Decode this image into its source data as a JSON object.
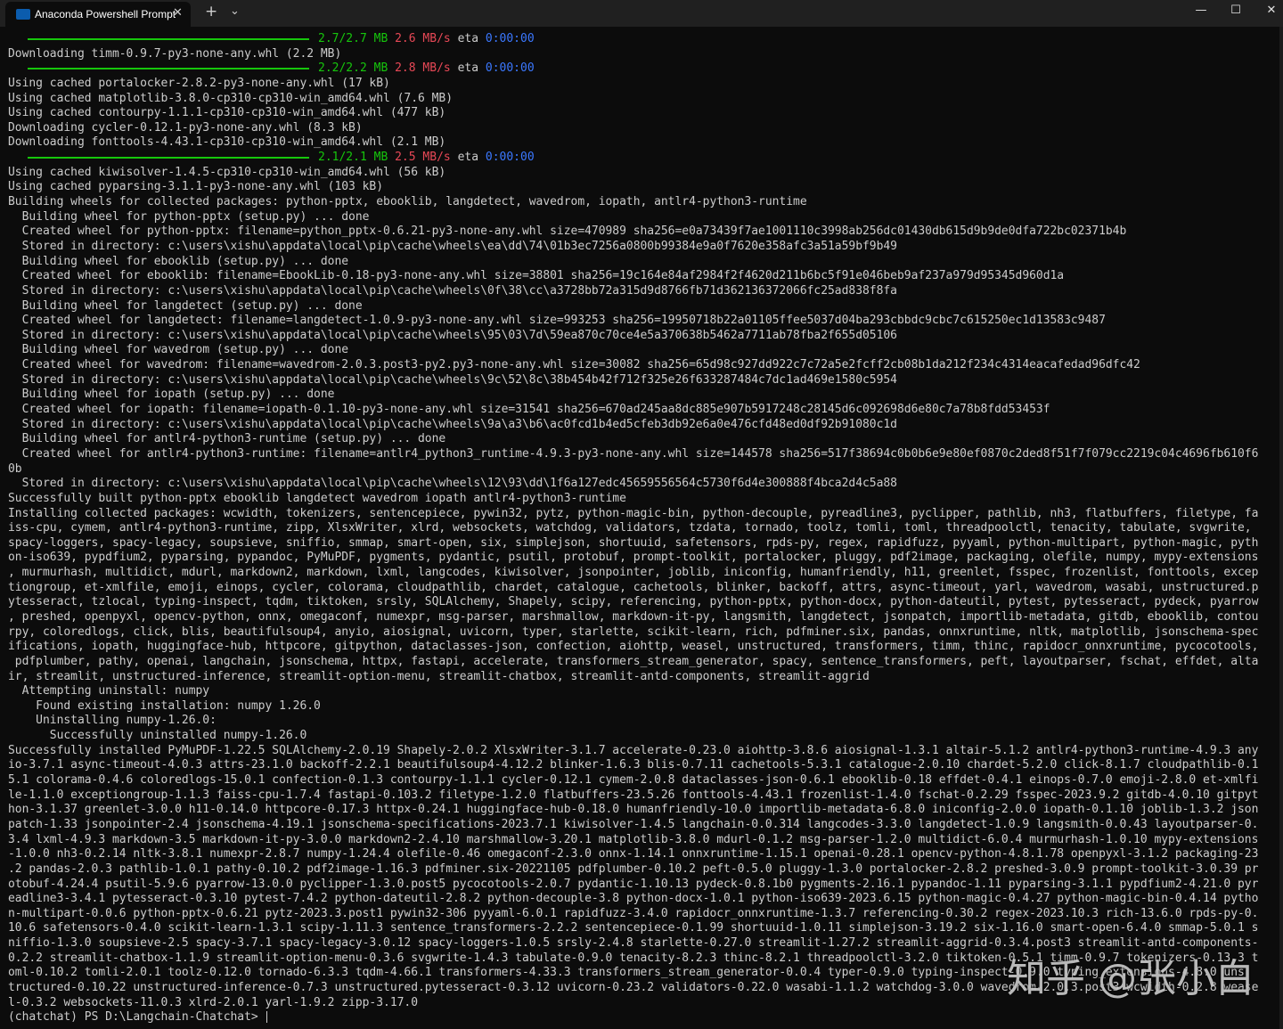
{
  "window": {
    "tab_title": "Anaconda Powershell Prompt",
    "tab_close": "✕",
    "new_tab": "+",
    "dropdown": "⌄",
    "minimize": "—",
    "maximize": "☐",
    "close": "✕"
  },
  "colors": {
    "background": "#0c0c0c",
    "titlebar": "#202020",
    "progress_green": "#16c60c",
    "speed_red": "#e74856",
    "eta_blue": "#3b78ff",
    "text": "#cccccc"
  },
  "progress": [
    {
      "size": "2.7/2.7 MB",
      "speed": "2.6 MB/s",
      "eta_label": "eta",
      "eta": "0:00:00"
    },
    {
      "size": "2.2/2.2 MB",
      "speed": "2.8 MB/s",
      "eta_label": "eta",
      "eta": "0:00:00"
    },
    {
      "size": "2.1/2.1 MB",
      "speed": "2.5 MB/s",
      "eta_label": "eta",
      "eta": "0:00:00"
    }
  ],
  "lines": {
    "l01": "Downloading timm-0.9.7-py3-none-any.whl (2.2 MB)",
    "l02": "Using cached portalocker-2.8.2-py3-none-any.whl (17 kB)",
    "l03": "Using cached matplotlib-3.8.0-cp310-cp310-win_amd64.whl (7.6 MB)",
    "l04": "Using cached contourpy-1.1.1-cp310-cp310-win_amd64.whl (477 kB)",
    "l05": "Downloading cycler-0.12.1-py3-none-any.whl (8.3 kB)",
    "l06": "Downloading fonttools-4.43.1-cp310-cp310-win_amd64.whl (2.1 MB)",
    "l07": "Using cached kiwisolver-1.4.5-cp310-cp310-win_amd64.whl (56 kB)",
    "l08": "Using cached pyparsing-3.1.1-py3-none-any.whl (103 kB)",
    "l09": "Building wheels for collected packages: python-pptx, ebooklib, langdetect, wavedrom, iopath, antlr4-python3-runtime",
    "l10": "  Building wheel for python-pptx (setup.py) ... done",
    "l11": "  Created wheel for python-pptx: filename=python_pptx-0.6.21-py3-none-any.whl size=470989 sha256=e0a73439f7ae1001110c3998ab256dc01430db615d9b9de0dfa722bc02371b4b",
    "l12": "  Stored in directory: c:\\users\\xishu\\appdata\\local\\pip\\cache\\wheels\\ea\\dd\\74\\01b3ec7256a0800b99384e9a0f7620e358afc3a51a59bf9b49",
    "l13": "  Building wheel for ebooklib (setup.py) ... done",
    "l14": "  Created wheel for ebooklib: filename=EbookLib-0.18-py3-none-any.whl size=38801 sha256=19c164e84af2984f2f4620d211b6bc5f91e046beb9af237a979d95345d960d1a",
    "l15": "  Stored in directory: c:\\users\\xishu\\appdata\\local\\pip\\cache\\wheels\\0f\\38\\cc\\a3728bb72a315d9d8766fb71d362136372066fc25ad838f8fa",
    "l16": "  Building wheel for langdetect (setup.py) ... done",
    "l17": "  Created wheel for langdetect: filename=langdetect-1.0.9-py3-none-any.whl size=993253 sha256=19950718b22a01105ffee5037d04ba293cbbdc9cbc7c615250ec1d13583c9487",
    "l18": "  Stored in directory: c:\\users\\xishu\\appdata\\local\\pip\\cache\\wheels\\95\\03\\7d\\59ea870c70ce4e5a370638b5462a7711ab78fba2f655d05106",
    "l19": "  Building wheel for wavedrom (setup.py) ... done",
    "l20": "  Created wheel for wavedrom: filename=wavedrom-2.0.3.post3-py2.py3-none-any.whl size=30082 sha256=65d98c927dd922c7c72a5e2fcff2cb08b1da212f234c4314eacafedad96dfc42",
    "l21": "  Stored in directory: c:\\users\\xishu\\appdata\\local\\pip\\cache\\wheels\\9c\\52\\8c\\38b454b42f712f325e26f633287484c7dc1ad469e1580c5954",
    "l22": "  Building wheel for iopath (setup.py) ... done",
    "l23": "  Created wheel for iopath: filename=iopath-0.1.10-py3-none-any.whl size=31541 sha256=670ad245aa8dc885e907b5917248c28145d6c092698d6e80c7a78b8fdd53453f",
    "l24": "  Stored in directory: c:\\users\\xishu\\appdata\\local\\pip\\cache\\wheels\\9a\\a3\\b6\\ac0fcd1b4ed5cfeb3db92e6a0e476cfd48ed0df92b91080c1d",
    "l25": "  Building wheel for antlr4-python3-runtime (setup.py) ... done",
    "l26": "  Created wheel for antlr4-python3-runtime: filename=antlr4_python3_runtime-4.9.3-py3-none-any.whl size=144578 sha256=517f38694c0b0b6e9e80ef0870c2ded8f51f7f079cc2219c04c4696fb610f6",
    "l27": "0b",
    "l28": "  Stored in directory: c:\\users\\xishu\\appdata\\local\\pip\\cache\\wheels\\12\\93\\dd\\1f6a127edc45659556564c5730f6d4e300888f4bca2d4c5a88",
    "l29": "Successfully built python-pptx ebooklib langdetect wavedrom iopath antlr4-python3-runtime",
    "l30": "Installing collected packages: wcwidth, tokenizers, sentencepiece, pywin32, pytz, python-magic-bin, python-decouple, pyreadline3, pyclipper, pathlib, nh3, flatbuffers, filetype, fa",
    "l31": "iss-cpu, cymem, antlr4-python3-runtime, zipp, XlsxWriter, xlrd, websockets, watchdog, validators, tzdata, tornado, toolz, tomli, toml, threadpoolctl, tenacity, tabulate, svgwrite,",
    "l32": "spacy-loggers, spacy-legacy, soupsieve, sniffio, smmap, smart-open, six, simplejson, shortuuid, safetensors, rpds-py, regex, rapidfuzz, pyyaml, python-multipart, python-magic, pyth",
    "l33": "on-iso639, pypdfium2, pyparsing, pypandoc, PyMuPDF, pygments, pydantic, psutil, protobuf, prompt-toolkit, portalocker, pluggy, pdf2image, packaging, olefile, numpy, mypy-extensions",
    "l34": ", murmurhash, multidict, mdurl, markdown2, markdown, lxml, langcodes, kiwisolver, jsonpointer, joblib, iniconfig, humanfriendly, h11, greenlet, fsspec, frozenlist, fonttools, excep",
    "l35": "tiongroup, et-xmlfile, emoji, einops, cycler, colorama, cloudpathlib, chardet, catalogue, cachetools, blinker, backoff, attrs, async-timeout, yarl, wavedrom, wasabi, unstructured.p",
    "l36": "ytesseract, tzlocal, typing-inspect, tqdm, tiktoken, srsly, SQLAlchemy, Shapely, scipy, referencing, python-pptx, python-docx, python-dateutil, pytest, pytesseract, pydeck, pyarrow",
    "l37": ", preshed, openpyxl, opencv-python, onnx, omegaconf, numexpr, msg-parser, marshmallow, markdown-it-py, langsmith, langdetect, jsonpatch, importlib-metadata, gitdb, ebooklib, contou",
    "l38": "rpy, coloredlogs, click, blis, beautifulsoup4, anyio, aiosignal, uvicorn, typer, starlette, scikit-learn, rich, pdfminer.six, pandas, onnxruntime, nltk, matplotlib, jsonschema-spec",
    "l39": "ifications, iopath, huggingface-hub, httpcore, gitpython, dataclasses-json, confection, aiohttp, weasel, unstructured, transformers, timm, thinc, rapidocr_onnxruntime, pycocotools,",
    "l40": " pdfplumber, pathy, openai, langchain, jsonschema, httpx, fastapi, accelerate, transformers_stream_generator, spacy, sentence_transformers, peft, layoutparser, fschat, effdet, alta",
    "l41": "ir, streamlit, unstructured-inference, streamlit-option-menu, streamlit-chatbox, streamlit-antd-components, streamlit-aggrid",
    "l42": "  Attempting uninstall: numpy",
    "l43": "    Found existing installation: numpy 1.26.0",
    "l44": "    Uninstalling numpy-1.26.0:",
    "l45": "      Successfully uninstalled numpy-1.26.0",
    "l46": "Successfully installed PyMuPDF-1.22.5 SQLAlchemy-2.0.19 Shapely-2.0.2 XlsxWriter-3.1.7 accelerate-0.23.0 aiohttp-3.8.6 aiosignal-1.3.1 altair-5.1.2 antlr4-python3-runtime-4.9.3 any",
    "l47": "io-3.7.1 async-timeout-4.0.3 attrs-23.1.0 backoff-2.2.1 beautifulsoup4-4.12.2 blinker-1.6.3 blis-0.7.11 cachetools-5.3.1 catalogue-2.0.10 chardet-5.2.0 click-8.1.7 cloudpathlib-0.1",
    "l48": "5.1 colorama-0.4.6 coloredlogs-15.0.1 confection-0.1.3 contourpy-1.1.1 cycler-0.12.1 cymem-2.0.8 dataclasses-json-0.6.1 ebooklib-0.18 effdet-0.4.1 einops-0.7.0 emoji-2.8.0 et-xmlfi",
    "l49": "le-1.1.0 exceptiongroup-1.1.3 faiss-cpu-1.7.4 fastapi-0.103.2 filetype-1.2.0 flatbuffers-23.5.26 fonttools-4.43.1 frozenlist-1.4.0 fschat-0.2.29 fsspec-2023.9.2 gitdb-4.0.10 gitpyt",
    "l50": "hon-3.1.37 greenlet-3.0.0 h11-0.14.0 httpcore-0.17.3 httpx-0.24.1 huggingface-hub-0.18.0 humanfriendly-10.0 importlib-metadata-6.8.0 iniconfig-2.0.0 iopath-0.1.10 joblib-1.3.2 json",
    "l51": "patch-1.33 jsonpointer-2.4 jsonschema-4.19.1 jsonschema-specifications-2023.7.1 kiwisolver-1.4.5 langchain-0.0.314 langcodes-3.3.0 langdetect-1.0.9 langsmith-0.0.43 layoutparser-0.",
    "l52": "3.4 lxml-4.9.3 markdown-3.5 markdown-it-py-3.0.0 markdown2-2.4.10 marshmallow-3.20.1 matplotlib-3.8.0 mdurl-0.1.2 msg-parser-1.2.0 multidict-6.0.4 murmurhash-1.0.10 mypy-extensions",
    "l53": "-1.0.0 nh3-0.2.14 nltk-3.8.1 numexpr-2.8.7 numpy-1.24.4 olefile-0.46 omegaconf-2.3.0 onnx-1.14.1 onnxruntime-1.15.1 openai-0.28.1 opencv-python-4.8.1.78 openpyxl-3.1.2 packaging-23",
    "l54": ".2 pandas-2.0.3 pathlib-1.0.1 pathy-0.10.2 pdf2image-1.16.3 pdfminer.six-20221105 pdfplumber-0.10.2 peft-0.5.0 pluggy-1.3.0 portalocker-2.8.2 preshed-3.0.9 prompt-toolkit-3.0.39 pr",
    "l55": "otobuf-4.24.4 psutil-5.9.6 pyarrow-13.0.0 pyclipper-1.3.0.post5 pycocotools-2.0.7 pydantic-1.10.13 pydeck-0.8.1b0 pygments-2.16.1 pypandoc-1.11 pyparsing-3.1.1 pypdfium2-4.21.0 pyr",
    "l56": "eadline3-3.4.1 pytesseract-0.3.10 pytest-7.4.2 python-dateutil-2.8.2 python-decouple-3.8 python-docx-1.0.1 python-iso639-2023.6.15 python-magic-0.4.27 python-magic-bin-0.4.14 pytho",
    "l57": "n-multipart-0.0.6 python-pptx-0.6.21 pytz-2023.3.post1 pywin32-306 pyyaml-6.0.1 rapidfuzz-3.4.0 rapidocr_onnxruntime-1.3.7 referencing-0.30.2 regex-2023.10.3 rich-13.6.0 rpds-py-0.",
    "l58": "10.6 safetensors-0.4.0 scikit-learn-1.3.1 scipy-1.11.3 sentence_transformers-2.2.2 sentencepiece-0.1.99 shortuuid-1.0.11 simplejson-3.19.2 six-1.16.0 smart-open-6.4.0 smmap-5.0.1 s",
    "l59": "niffio-1.3.0 soupsieve-2.5 spacy-3.7.1 spacy-legacy-3.0.12 spacy-loggers-1.0.5 srsly-2.4.8 starlette-0.27.0 streamlit-1.27.2 streamlit-aggrid-0.3.4.post3 streamlit-antd-components-",
    "l60": "0.2.2 streamlit-chatbox-1.1.9 streamlit-option-menu-0.3.6 svgwrite-1.4.3 tabulate-0.9.0 tenacity-8.2.3 thinc-8.2.1 threadpoolctl-3.2.0 tiktoken-0.5.1 timm-0.9.7 tokenizers-0.13.3 t",
    "l61": "oml-0.10.2 tomli-2.0.1 toolz-0.12.0 tornado-6.3.3 tqdm-4.66.1 transformers-4.33.3 transformers_stream_generator-0.0.4 typer-0.9.0 typing-inspect-0.9.0 typing_extensions-4.8.0 uns",
    "l62": "tructured-0.10.22 unstructured-inference-0.7.3 unstructured.pytesseract-0.3.12 uvicorn-0.23.2 validators-0.22.0 wasabi-1.1.2 watchdog-3.0.0 wavedrom-2.0.3.post3 wcwidth-0.2.8 wease",
    "l63": "l-0.3.2 websockets-11.0.3 xlrd-2.0.1 yarl-1.9.2 zipp-3.17.0",
    "l64": "(chatchat) PS D:\\Langchain-Chatchat> "
  },
  "watermark": "知乎 @张小白"
}
